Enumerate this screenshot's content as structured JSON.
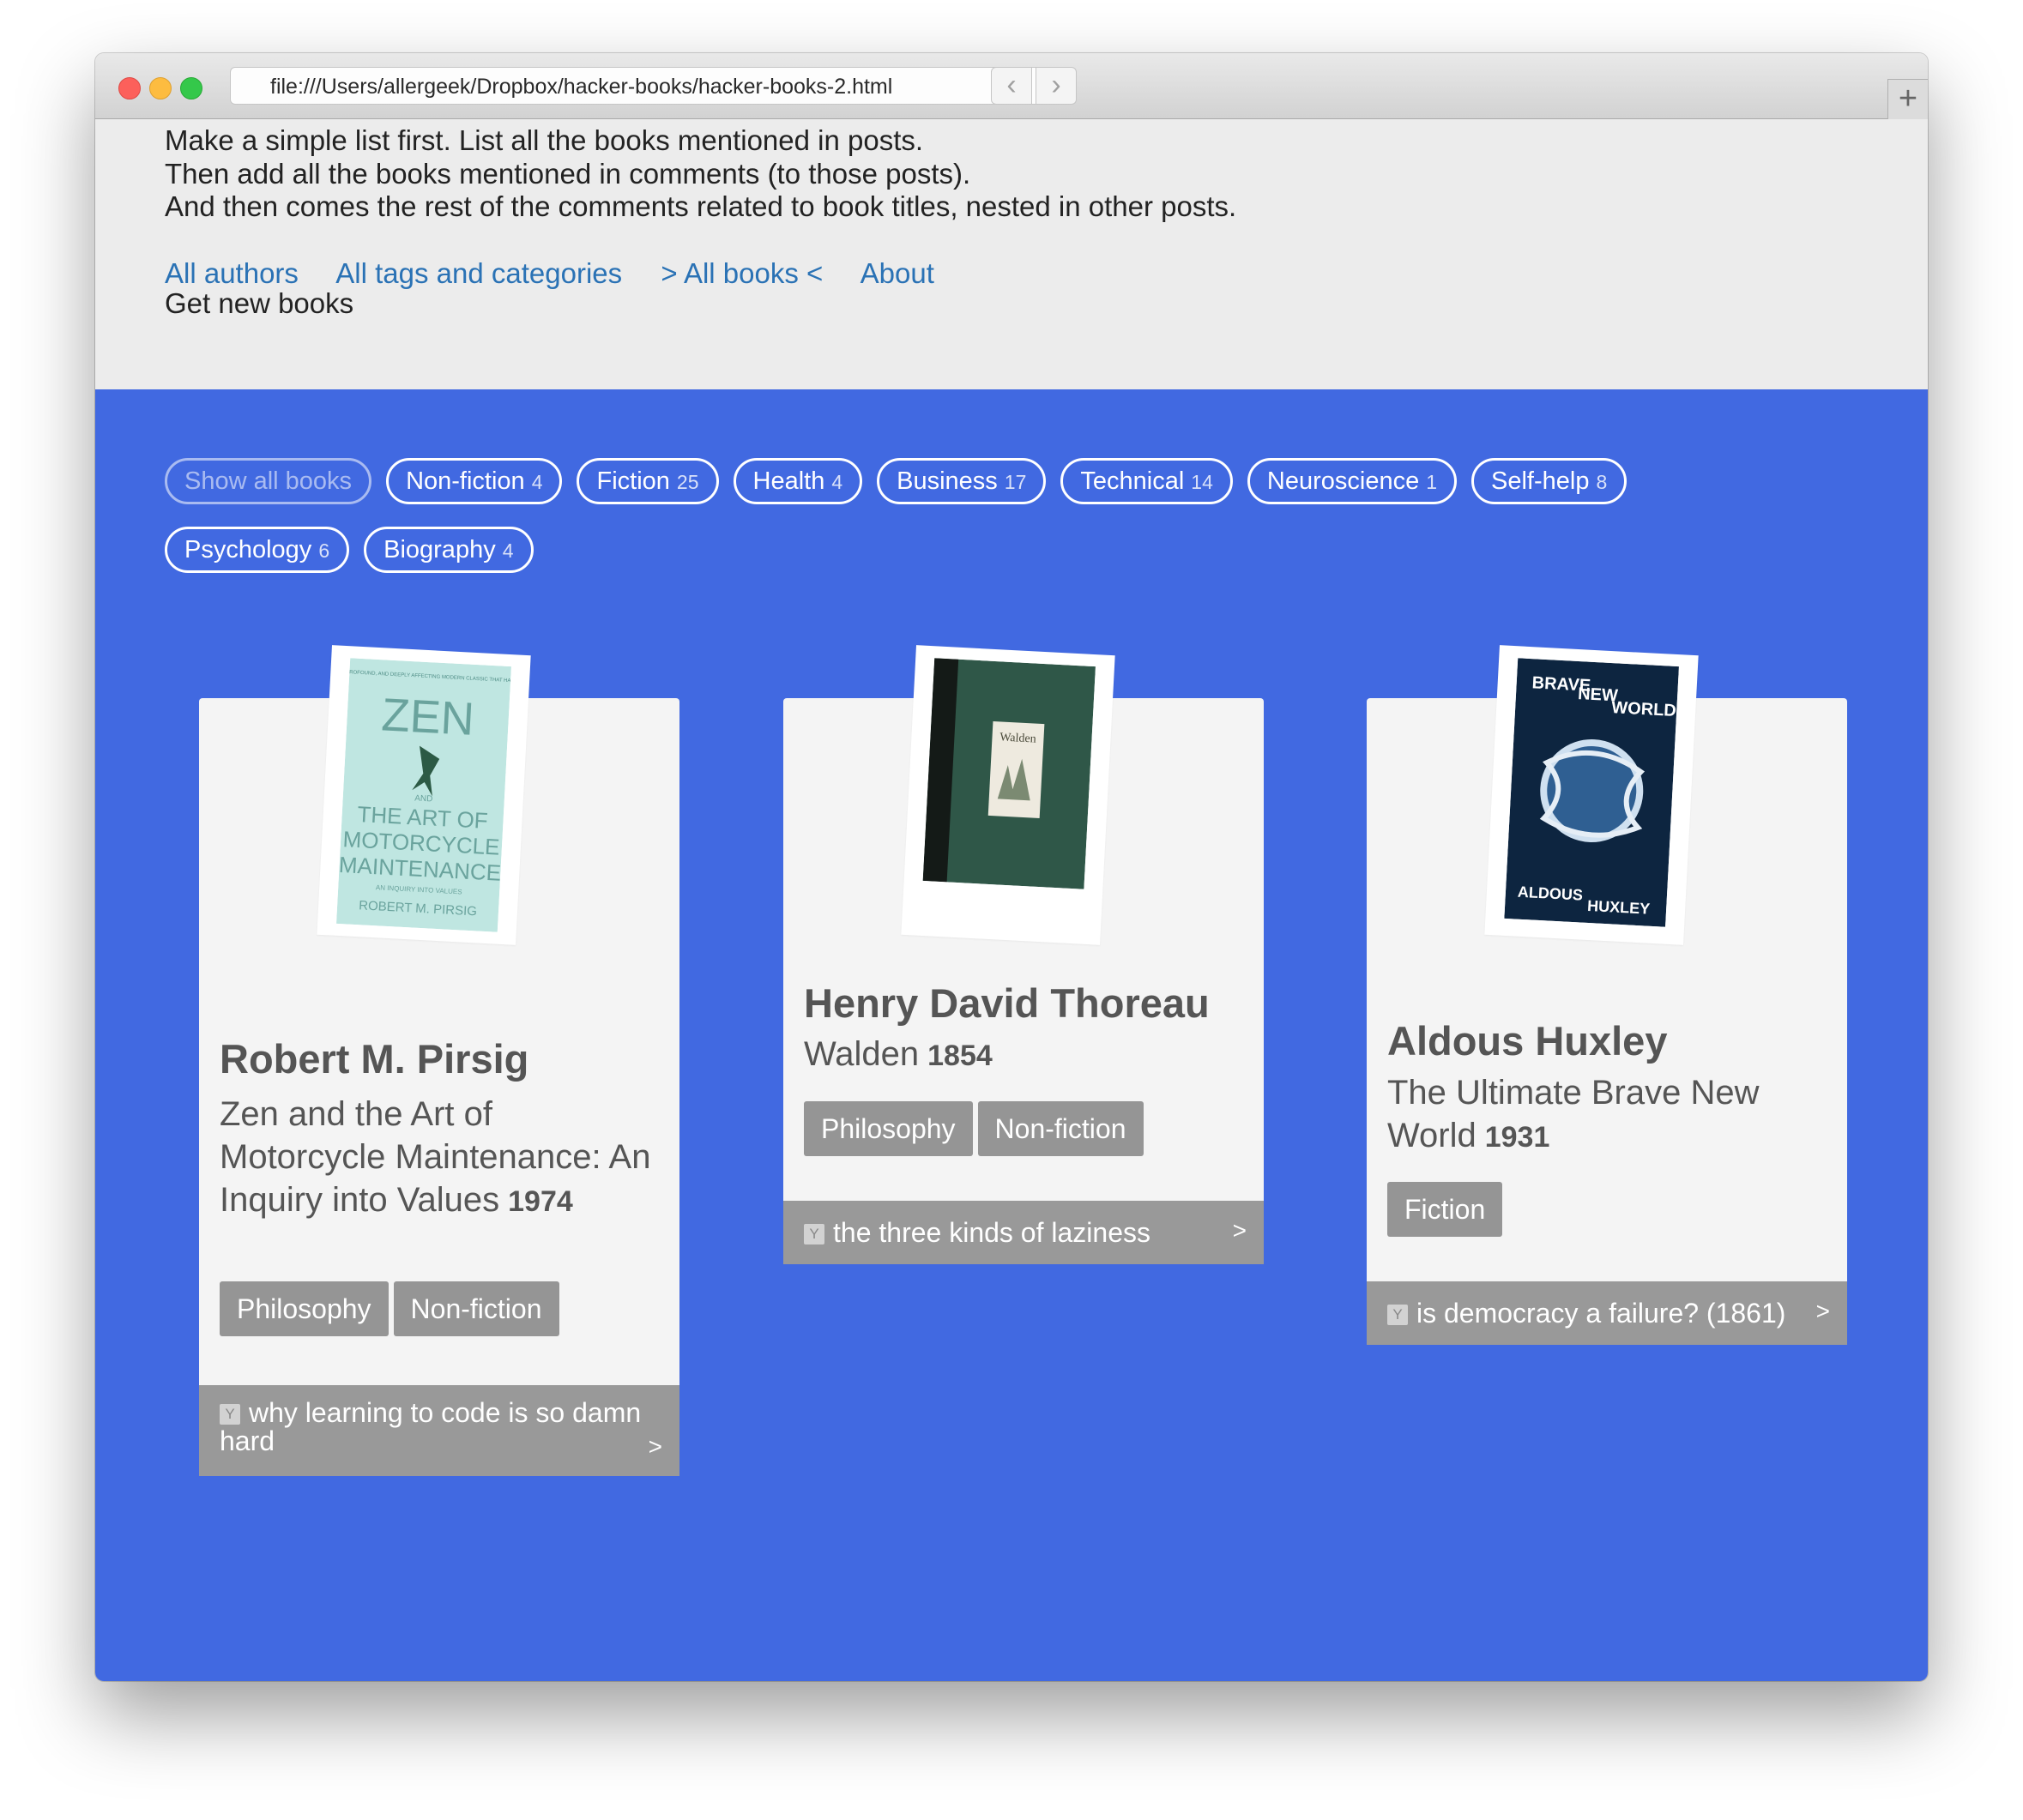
{
  "browser": {
    "url": "file:///Users/allergeek/Dropbox/hacker-books/hacker-books-2.html"
  },
  "intro": {
    "lines": [
      "Make a simple list first. List all the books mentioned in posts.",
      "Then add all the books mentioned in comments (to those posts).",
      "And then comes the rest of the comments related to book titles, nested in other posts."
    ]
  },
  "nav": {
    "links": [
      "All authors",
      "All tags and categories",
      "> All books <",
      "About"
    ],
    "get_new": "Get new books"
  },
  "filters": [
    {
      "label": "Show all books",
      "count": ""
    },
    {
      "label": "Non-fiction",
      "count": "4"
    },
    {
      "label": "Fiction",
      "count": "25"
    },
    {
      "label": "Health",
      "count": "4"
    },
    {
      "label": "Business",
      "count": "17"
    },
    {
      "label": "Technical",
      "count": "14"
    },
    {
      "label": "Neuroscience",
      "count": "1"
    },
    {
      "label": "Self-help",
      "count": "8"
    },
    {
      "label": "Psychology",
      "count": "6"
    },
    {
      "label": "Biography",
      "count": "4"
    }
  ],
  "books": [
    {
      "author": "Robert M. Pirsig",
      "title": "Zen and the Art of Motorcycle Maintenance: An Inquiry into Values",
      "year": "1974",
      "tags": [
        "Philosophy",
        "Non-fiction"
      ],
      "hn_link": "why learning to code is so damn hard",
      "cover": {
        "top_text": "THE PROVOCATIVE, PROFOUND, AND DEEPLY AFFECTING MODERN CLASSIC THAT HAS INSPIRED MILLIONS",
        "zen": "ZEN",
        "and": "AND",
        "title_lines": [
          "THE ART OF",
          "MOTORCYCLE",
          "MAINTENANCE"
        ],
        "subtitle": "AN INQUIRY INTO VALUES",
        "author": "ROBERT M. PIRSIG",
        "color": "#bfe6e1"
      }
    },
    {
      "author": "Henry David Thoreau",
      "title": "Walden",
      "year": "1854",
      "tags": [
        "Philosophy",
        "Non-fiction"
      ],
      "hn_link": "the three kinds of laziness",
      "cover": {
        "title": "Walden",
        "color": "#2f5748"
      }
    },
    {
      "author": "Aldous Huxley",
      "title": "The Ultimate Brave New World",
      "year": "1931",
      "tags": [
        "Fiction"
      ],
      "hn_link": "is democracy a failure? (1861)",
      "cover": {
        "top": [
          "BRAVE",
          "NEW",
          "WORLD"
        ],
        "bottom": [
          "ALDOUS",
          "HUXLEY"
        ],
        "color": "#0d2540"
      }
    }
  ],
  "hn_badge": "Y",
  "hn_arrow": ">",
  "colors": {
    "accent_blue": "#4169e1",
    "link": "#2a72b5",
    "tag_gray": "#959595"
  }
}
